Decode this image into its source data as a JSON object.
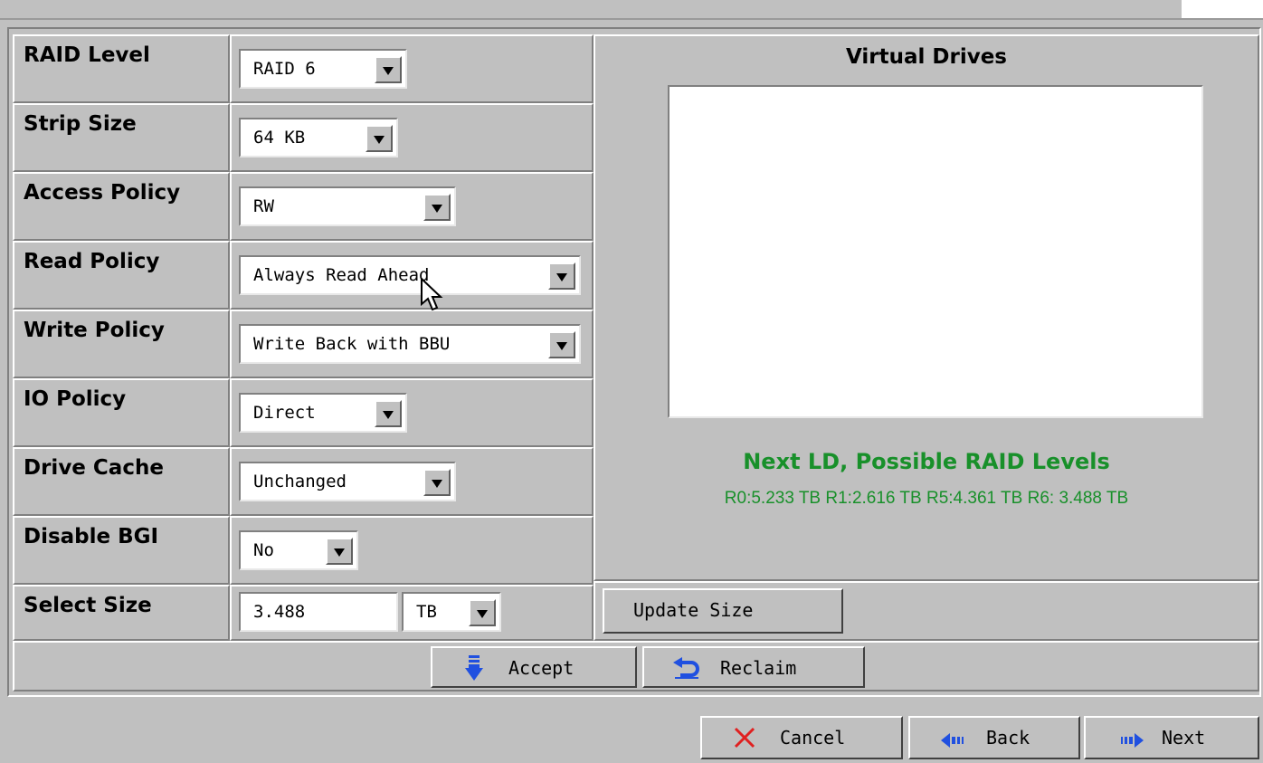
{
  "left_fields": [
    {
      "label": "RAID Level",
      "value": "RAID 6"
    },
    {
      "label": "Strip Size",
      "value": "64 KB"
    },
    {
      "label": "Access Policy",
      "value": "RW"
    },
    {
      "label": "Read Policy",
      "value": "Always Read Ahead"
    },
    {
      "label": "Write Policy",
      "value": "Write Back with BBU"
    },
    {
      "label": "IO Policy",
      "value": "Direct"
    },
    {
      "label": "Drive Cache",
      "value": "Unchanged"
    },
    {
      "label": "Disable BGI",
      "value": "No"
    },
    {
      "label": "Select Size",
      "value": "3.488",
      "unit": "TB"
    }
  ],
  "virtual_drives": {
    "title": "Virtual Drives",
    "next_ld_title": "Next LD, Possible RAID Levels",
    "next_ld_values": "R0:5.233 TB  R1:2.616 TB  R5:4.361 TB  R6: 3.488 TB"
  },
  "buttons": {
    "update_size": "Update Size",
    "accept": "Accept",
    "reclaim": "Reclaim",
    "cancel": "Cancel",
    "back": "Back",
    "next": "Next"
  },
  "colors": {
    "background": "#c0c0c0",
    "accent_green": "#18902a",
    "icon_blue": "#2050e0",
    "cancel_red": "#e02020"
  }
}
